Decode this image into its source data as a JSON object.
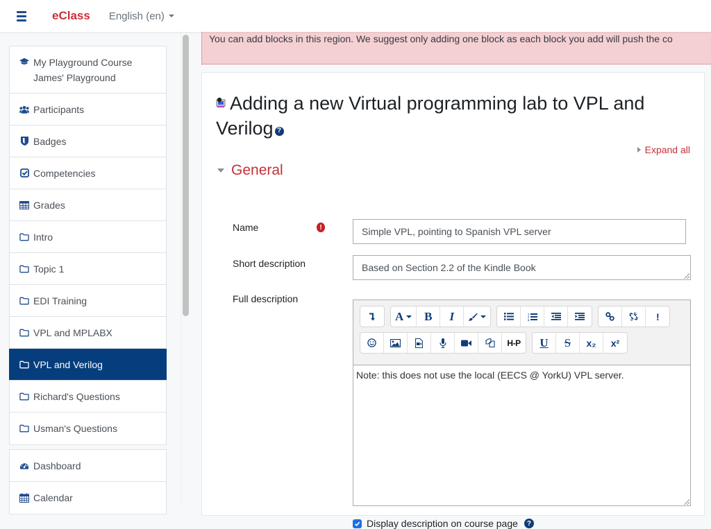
{
  "navbar": {
    "brand": "eClass",
    "language": "English (en)"
  },
  "sidebar": {
    "course_items": [
      {
        "label": "My Playground Course James' Playground",
        "icon": "graduation-cap-icon",
        "active": false
      },
      {
        "label": "Participants",
        "icon": "users-icon",
        "active": false
      },
      {
        "label": "Badges",
        "icon": "shield-icon",
        "active": false
      },
      {
        "label": "Competencies",
        "icon": "check-square-icon",
        "active": false
      },
      {
        "label": "Grades",
        "icon": "table-icon",
        "active": false
      },
      {
        "label": "Intro",
        "icon": "folder-icon",
        "active": false
      },
      {
        "label": "Topic 1",
        "icon": "folder-icon",
        "active": false
      },
      {
        "label": "EDI Training",
        "icon": "folder-icon",
        "active": false
      },
      {
        "label": "VPL and MPLABX",
        "icon": "folder-icon",
        "active": false
      },
      {
        "label": "VPL and Verilog",
        "icon": "folder-icon",
        "active": true
      },
      {
        "label": "Richard's Questions",
        "icon": "folder-icon",
        "active": false
      },
      {
        "label": "Usman's Questions",
        "icon": "folder-icon",
        "active": false
      }
    ],
    "site_items": [
      {
        "label": "Dashboard",
        "icon": "dashboard-icon"
      },
      {
        "label": "Calendar",
        "icon": "calendar-icon"
      }
    ]
  },
  "block_region": {
    "message": "You can add blocks in this region. We suggest only adding one block as each block you add will push the co"
  },
  "page": {
    "title": "Adding a new Virtual programming lab to VPL and Verilog",
    "expand_all": "Expand all",
    "section": "General"
  },
  "form": {
    "name_label": "Name",
    "name_value": "Simple VPL, pointing to Spanish VPL server",
    "short_desc_label": "Short description",
    "short_desc_value": "Based on Section 2.2 of the Kindle Book",
    "full_desc_label": "Full description",
    "full_desc_value": "Note: this does not use the local (EECS @ YorkU) VPL server.",
    "display_desc_label": "Display description on course page",
    "display_desc_checked": true
  },
  "toolbar": {
    "row1": [
      [
        {
          "label": "↴",
          "name": "toolbar-toggle-button"
        }
      ],
      [
        {
          "label": "A",
          "name": "font-style-button",
          "dropdown": true
        },
        {
          "label": "B",
          "name": "bold-button"
        },
        {
          "label": "I",
          "name": "italic-button"
        },
        {
          "label": "🖌",
          "name": "font-color-button",
          "dropdown": true
        }
      ],
      [
        {
          "label": "☰",
          "name": "unordered-list-button"
        },
        {
          "label": "≡",
          "name": "ordered-list-button"
        },
        {
          "label": "⇤",
          "name": "outdent-button"
        },
        {
          "label": "⇥",
          "name": "indent-button"
        }
      ],
      [
        {
          "label": "∞",
          "name": "link-button"
        },
        {
          "label": "⨯",
          "name": "unlink-button"
        },
        {
          "label": "!",
          "name": "accessibility-button"
        }
      ]
    ],
    "row2": [
      [
        {
          "label": "☺",
          "name": "emoticon-button"
        },
        {
          "label": "▣",
          "name": "image-button"
        },
        {
          "label": "▤",
          "name": "media-button"
        },
        {
          "label": "🎙",
          "name": "record-audio-button"
        },
        {
          "label": "■",
          "name": "record-video-button"
        },
        {
          "label": "⧉",
          "name": "manage-files-button"
        },
        {
          "label": "H-P",
          "name": "h5p-button"
        }
      ],
      [
        {
          "label": "U",
          "name": "underline-button"
        },
        {
          "label": "S",
          "name": "strikethrough-button"
        },
        {
          "label": "x₂",
          "name": "subscript-button"
        },
        {
          "label": "x²",
          "name": "superscript-button"
        }
      ]
    ]
  }
}
